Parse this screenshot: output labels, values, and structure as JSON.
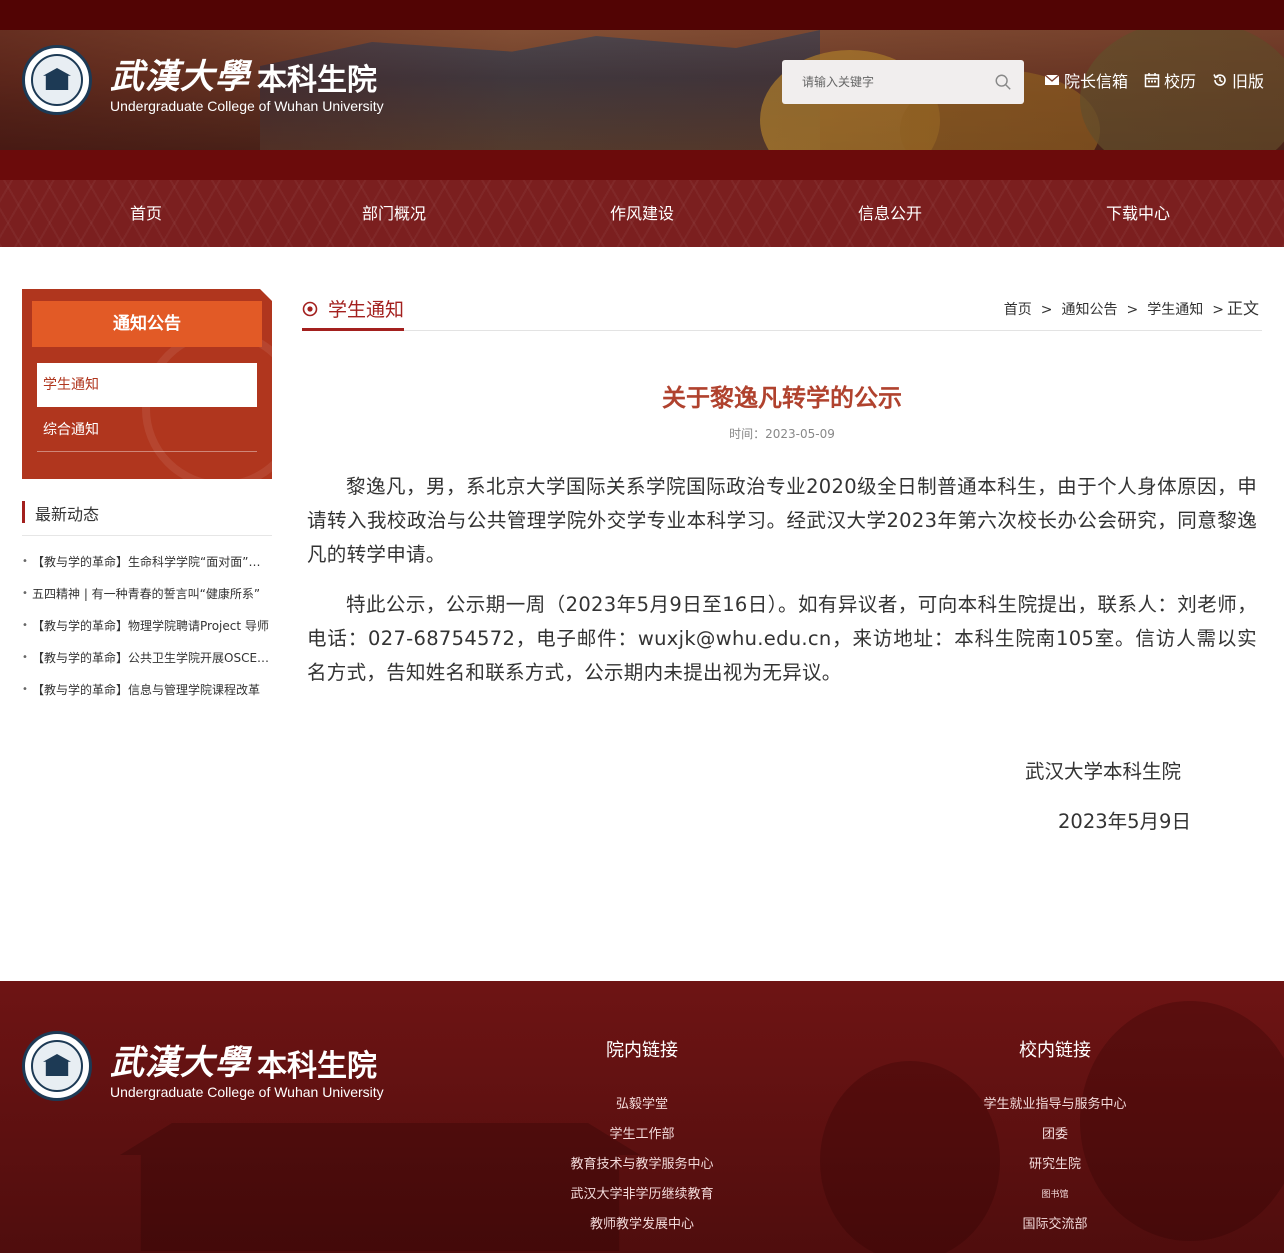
{
  "header": {
    "logo_cn_calligraphy": "武漢大學",
    "logo_cn_name": "本科生院",
    "logo_en": "Undergraduate College of Wuhan University",
    "search_placeholder": "请输入关键字",
    "links": [
      {
        "label": "院长信箱",
        "icon": "envelope-icon"
      },
      {
        "label": "校历",
        "icon": "calendar-icon"
      },
      {
        "label": "旧版",
        "icon": "history-icon"
      }
    ]
  },
  "nav": {
    "items": [
      "首页",
      "部门概况",
      "作风建设",
      "信息公开",
      "下载中心"
    ]
  },
  "sidebar": {
    "title": "通知公告",
    "items": [
      "学生通知",
      "综合通知"
    ],
    "latest_title": "最新动态",
    "latest": [
      "【教与学的革命】生命科学学院“面对面”交流会",
      "五四精神 | 有一种青春的誓言叫“健康所系”",
      "【教与学的革命】物理学院聘请Project 导师",
      "【教与学的革命】公共卫生学院开展OSCE考核",
      "【教与学的革命】信息与管理学院课程改革"
    ]
  },
  "content": {
    "section_title": "学生通知",
    "breadcrumb": [
      "首页",
      "通知公告",
      "学生通知",
      "正文"
    ],
    "article_title": "关于黎逸凡转学的公示",
    "date_label": "时间：",
    "date": "2023-05-09",
    "paragraphs": [
      "黎逸凡，男，系北京大学国际关系学院国际政治专业2020级全日制普通本科生，由于个人身体原因，申请转入我校政治与公共管理学院外交学专业本科学习。经武汉大学2023年第六次校长办公会研究，同意黎逸凡的转学申请。",
      "特此公示，公示期一周（2023年5月9日至16日）。如有异议者，可向本科生院提出，联系人：刘老师，电话：027-68754572，电子邮件：wuxjk@whu.edu.cn，来访地址：本科生院南105室。信访人需以实名方式，告知姓名和联系方式，公示期内未提出视为无异议。"
    ],
    "signature": "武汉大学本科生院",
    "signature_date": "2023年5月9日"
  },
  "footer": {
    "col1_title": "院内链接",
    "col1_links": [
      "弘毅学堂",
      "学生工作部",
      "教育技术与教学服务中心",
      "武汉大学非学历继续教育",
      "教师教学发展中心"
    ],
    "col2_title": "校内链接",
    "col2_links": [
      "学生就业指导与服务中心",
      "团委",
      "研究生院",
      "图书馆",
      "国际交流部"
    ]
  },
  "colors": {
    "brand_dark": "#520404",
    "nav": "#7b1f1f",
    "accent": "#a3201e",
    "sidebar": "#b0361e",
    "sidebar_title": "#e25a26",
    "title_red": "#b0422e"
  }
}
